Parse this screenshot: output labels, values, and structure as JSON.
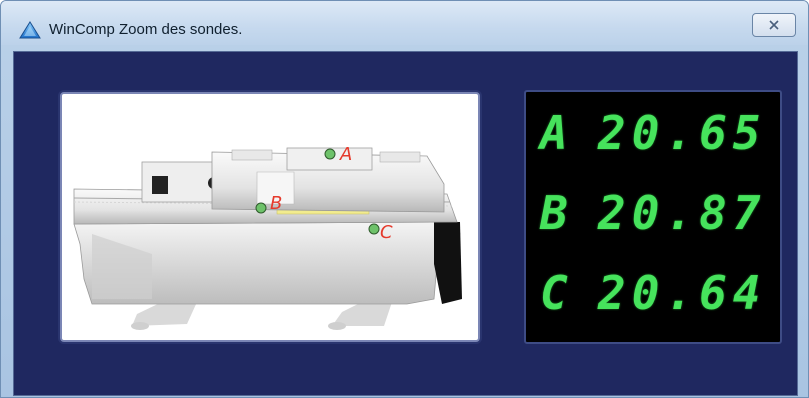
{
  "window": {
    "title": "WinComp Zoom des sondes.",
    "close_label": "✕"
  },
  "image": {
    "probe_labels": [
      "A",
      "B",
      "C"
    ]
  },
  "readouts": [
    {
      "letter": "A",
      "value": "20.65"
    },
    {
      "letter": "B",
      "value": "20.87"
    },
    {
      "letter": "C",
      "value": "20.64"
    }
  ],
  "colors": {
    "client_bg": "#1f2860",
    "lcd_green": "#46e35c",
    "probe_label": "#e53a2c",
    "probe_dot": "#6ec26a"
  }
}
